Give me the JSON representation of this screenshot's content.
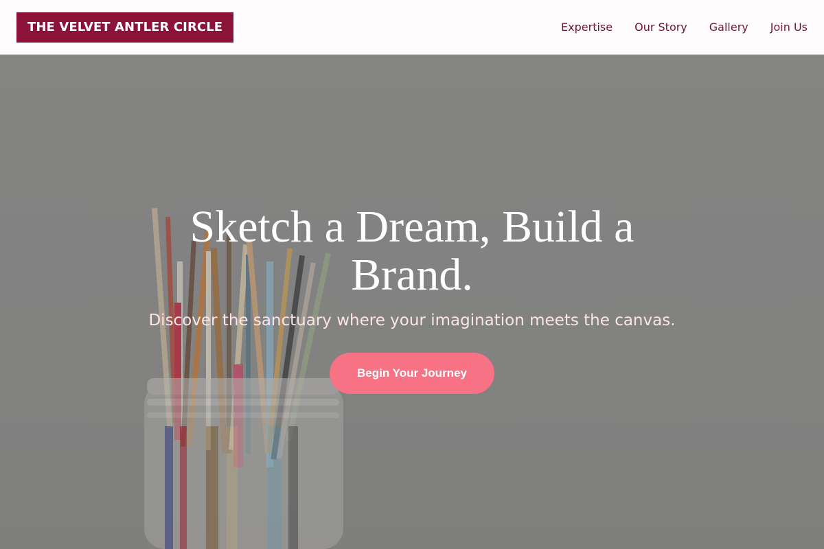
{
  "header": {
    "logo": "THE VELVET ANTLER CIRCLE",
    "nav": [
      "Expertise",
      "Our Story",
      "Gallery",
      "Join Us"
    ]
  },
  "hero": {
    "title": "Sketch a Dream, Build a Brand.",
    "subtitle": "Discover the sanctuary where your imagination meets the canvas.",
    "cta": "Begin Your Journey"
  },
  "colors": {
    "brand": "#8b1238",
    "nav_text": "#6f1535",
    "accent": "#f67284",
    "subtitle": "#fbe3e8"
  }
}
